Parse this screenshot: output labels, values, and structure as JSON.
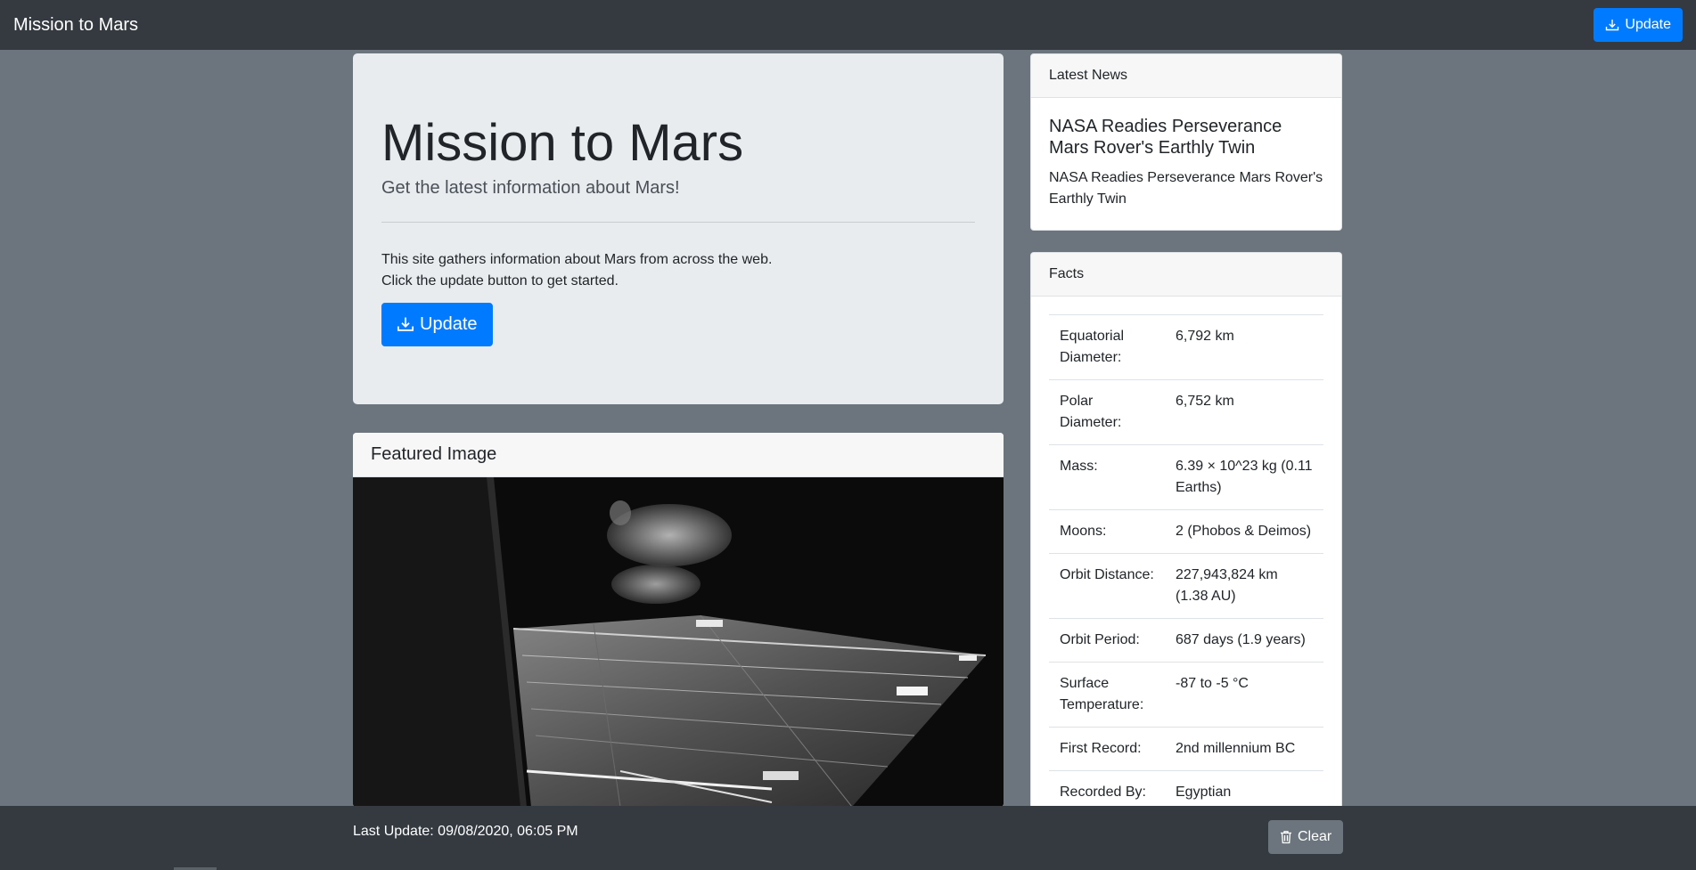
{
  "navbar": {
    "brand": "Mission to Mars",
    "update_label": "Update",
    "update_icon": "download-icon"
  },
  "jumbotron": {
    "title": "Mission to Mars",
    "lead": "Get the latest information about Mars!",
    "line1": "This site gathers information about Mars from across the web.",
    "line2": "Click the update button to get started.",
    "update_label": "Update"
  },
  "featured": {
    "header": "Featured Image"
  },
  "news": {
    "header": "Latest News",
    "title": "NASA Readies Perseverance Mars Rover's Earthly Twin",
    "teaser": "NASA Readies Perseverance Mars Rover's Earthly Twin"
  },
  "facts": {
    "header": "Facts",
    "rows": [
      {
        "key": "Equatorial Diameter:",
        "value": "6,792 km"
      },
      {
        "key": "Polar Diameter:",
        "value": "6,752 km"
      },
      {
        "key": "Mass:",
        "value": "6.39 × 10^23 kg (0.11 Earths)"
      },
      {
        "key": "Moons:",
        "value": "2 (Phobos & Deimos)"
      },
      {
        "key": "Orbit Distance:",
        "value": "227,943,824 km (1.38 AU)"
      },
      {
        "key": "Orbit Period:",
        "value": "687 days (1.9 years)"
      },
      {
        "key": "Surface Temperature:",
        "value": "-87 to -5 °C"
      },
      {
        "key": "First Record:",
        "value": "2nd millennium BC"
      },
      {
        "key": "Recorded By:",
        "value": "Egyptian"
      }
    ]
  },
  "footer": {
    "last_update": "Last Update: 09/08/2020, 06:05 PM",
    "clear_label": "Clear",
    "clear_icon": "trash-icon"
  }
}
